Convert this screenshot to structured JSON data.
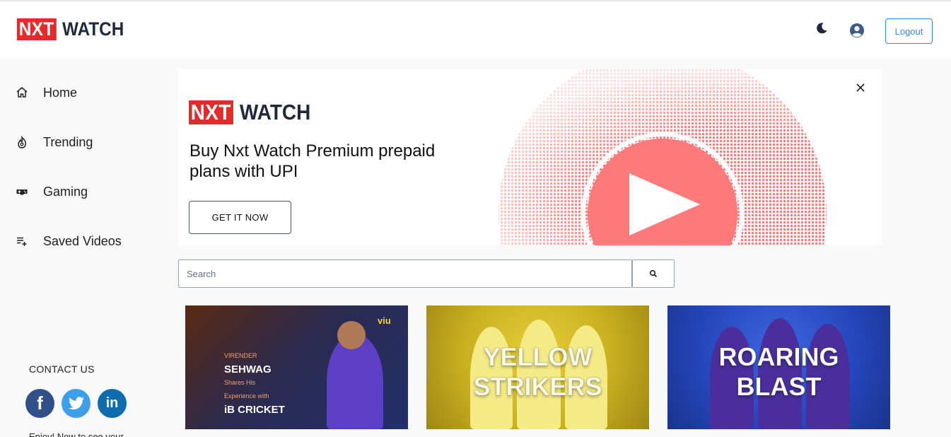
{
  "header": {
    "logo_box": "NXT",
    "logo_text": "WATCH",
    "logout_label": "Logout",
    "theme_icon": "moon-icon",
    "profile_icon": "user-circle-icon"
  },
  "sidebar": {
    "items": [
      {
        "label": "Home",
        "icon": "home-icon"
      },
      {
        "label": "Trending",
        "icon": "fire-icon"
      },
      {
        "label": "Gaming",
        "icon": "gamepad-icon"
      },
      {
        "label": "Saved Videos",
        "icon": "playlist-add-icon"
      }
    ],
    "contact_title": "CONTACT US",
    "social": [
      {
        "name": "facebook",
        "glyph": "f"
      },
      {
        "name": "twitter",
        "glyph": ""
      },
      {
        "name": "linkedin",
        "glyph": "in"
      }
    ],
    "enjoy_text": "Enjoy! Now to see your"
  },
  "banner": {
    "logo_box": "NXT",
    "logo_text": "WATCH",
    "title": "Buy Nxt Watch Premium prepaid plans with UPI",
    "cta_label": "GET IT NOW",
    "close_icon": "close-icon"
  },
  "search": {
    "placeholder": "Search",
    "value": "",
    "button_icon": "search-icon"
  },
  "videos": [
    {
      "thumb_lines": [
        "VIRENDER",
        "SEHWAG",
        "Shares His",
        "Experience with",
        "iB CRICKET"
      ],
      "badge": "viu"
    },
    {
      "thumb_lines": [
        "YELLOW",
        "STRIKERS"
      ]
    },
    {
      "thumb_lines": [
        "ROARING",
        "BLAST"
      ]
    }
  ],
  "colors": {
    "brand_red": "#e42a2a",
    "logout_blue": "#3b82f6",
    "banner_art": "#ff7b7b",
    "sidebar_bg": "#f9f9f9"
  }
}
